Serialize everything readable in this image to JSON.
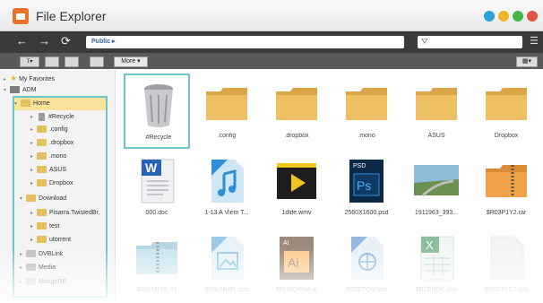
{
  "window": {
    "title": "File Explorer"
  },
  "nav": {
    "path": "Public",
    "path_sep": "▸"
  },
  "toolbar": {
    "more_label": "More"
  },
  "sidebar": {
    "favorites": "My Favorites",
    "adm": "ADM",
    "home": "Home",
    "items": [
      "#Recycle",
      ".config",
      ".dropbox",
      ".mono",
      "ASUS",
      "Dropbox"
    ],
    "download": "Download",
    "download_items": [
      "Pisarra.TwistedBr.",
      "test",
      "utorrent"
    ],
    "bottom": [
      "DVBLink",
      "Media",
      "MongoDB"
    ]
  },
  "files": [
    {
      "label": "#Recycle",
      "icon": "recycle-bin-icon"
    },
    {
      "label": ".config",
      "icon": "folder-icon"
    },
    {
      "label": ".dropbox",
      "icon": "folder-icon"
    },
    {
      "label": ".mono",
      "icon": "folder-icon"
    },
    {
      "label": "ASUS",
      "icon": "folder-icon"
    },
    {
      "label": "Dropbox",
      "icon": "folder-icon"
    },
    {
      "label": "000.doc",
      "icon": "word-doc-icon"
    },
    {
      "label": "1-13 A Vlem T...",
      "icon": "mp3-icon"
    },
    {
      "label": "1dlife.wmv",
      "icon": "video-icon"
    },
    {
      "label": "2560X1600.psd",
      "icon": "psd-icon"
    },
    {
      "label": "1911963_393...",
      "icon": "image-thumbnail-icon"
    },
    {
      "label": "$R03P1Y2.rar",
      "icon": "zip-folder-icon"
    },
    {
      "label": "$RALMH6L.7z",
      "icon": "archive-icon"
    },
    {
      "label": "$RALMH6L.eps",
      "icon": "eps-icon"
    },
    {
      "label": "$RHBQRHA.ai",
      "icon": "ai-icon"
    },
    {
      "label": "$RZETQN.htm",
      "icon": "html-icon"
    },
    {
      "label": "$RZENDK.xlsx",
      "icon": "excel-icon"
    },
    {
      "label": "$RSRF0D7.svg",
      "icon": "generic-file-icon"
    }
  ],
  "colors": {
    "accent_selection": "#6cc7c7",
    "folder": "#e9b85c",
    "titlebar_logo": "#e8742c"
  }
}
